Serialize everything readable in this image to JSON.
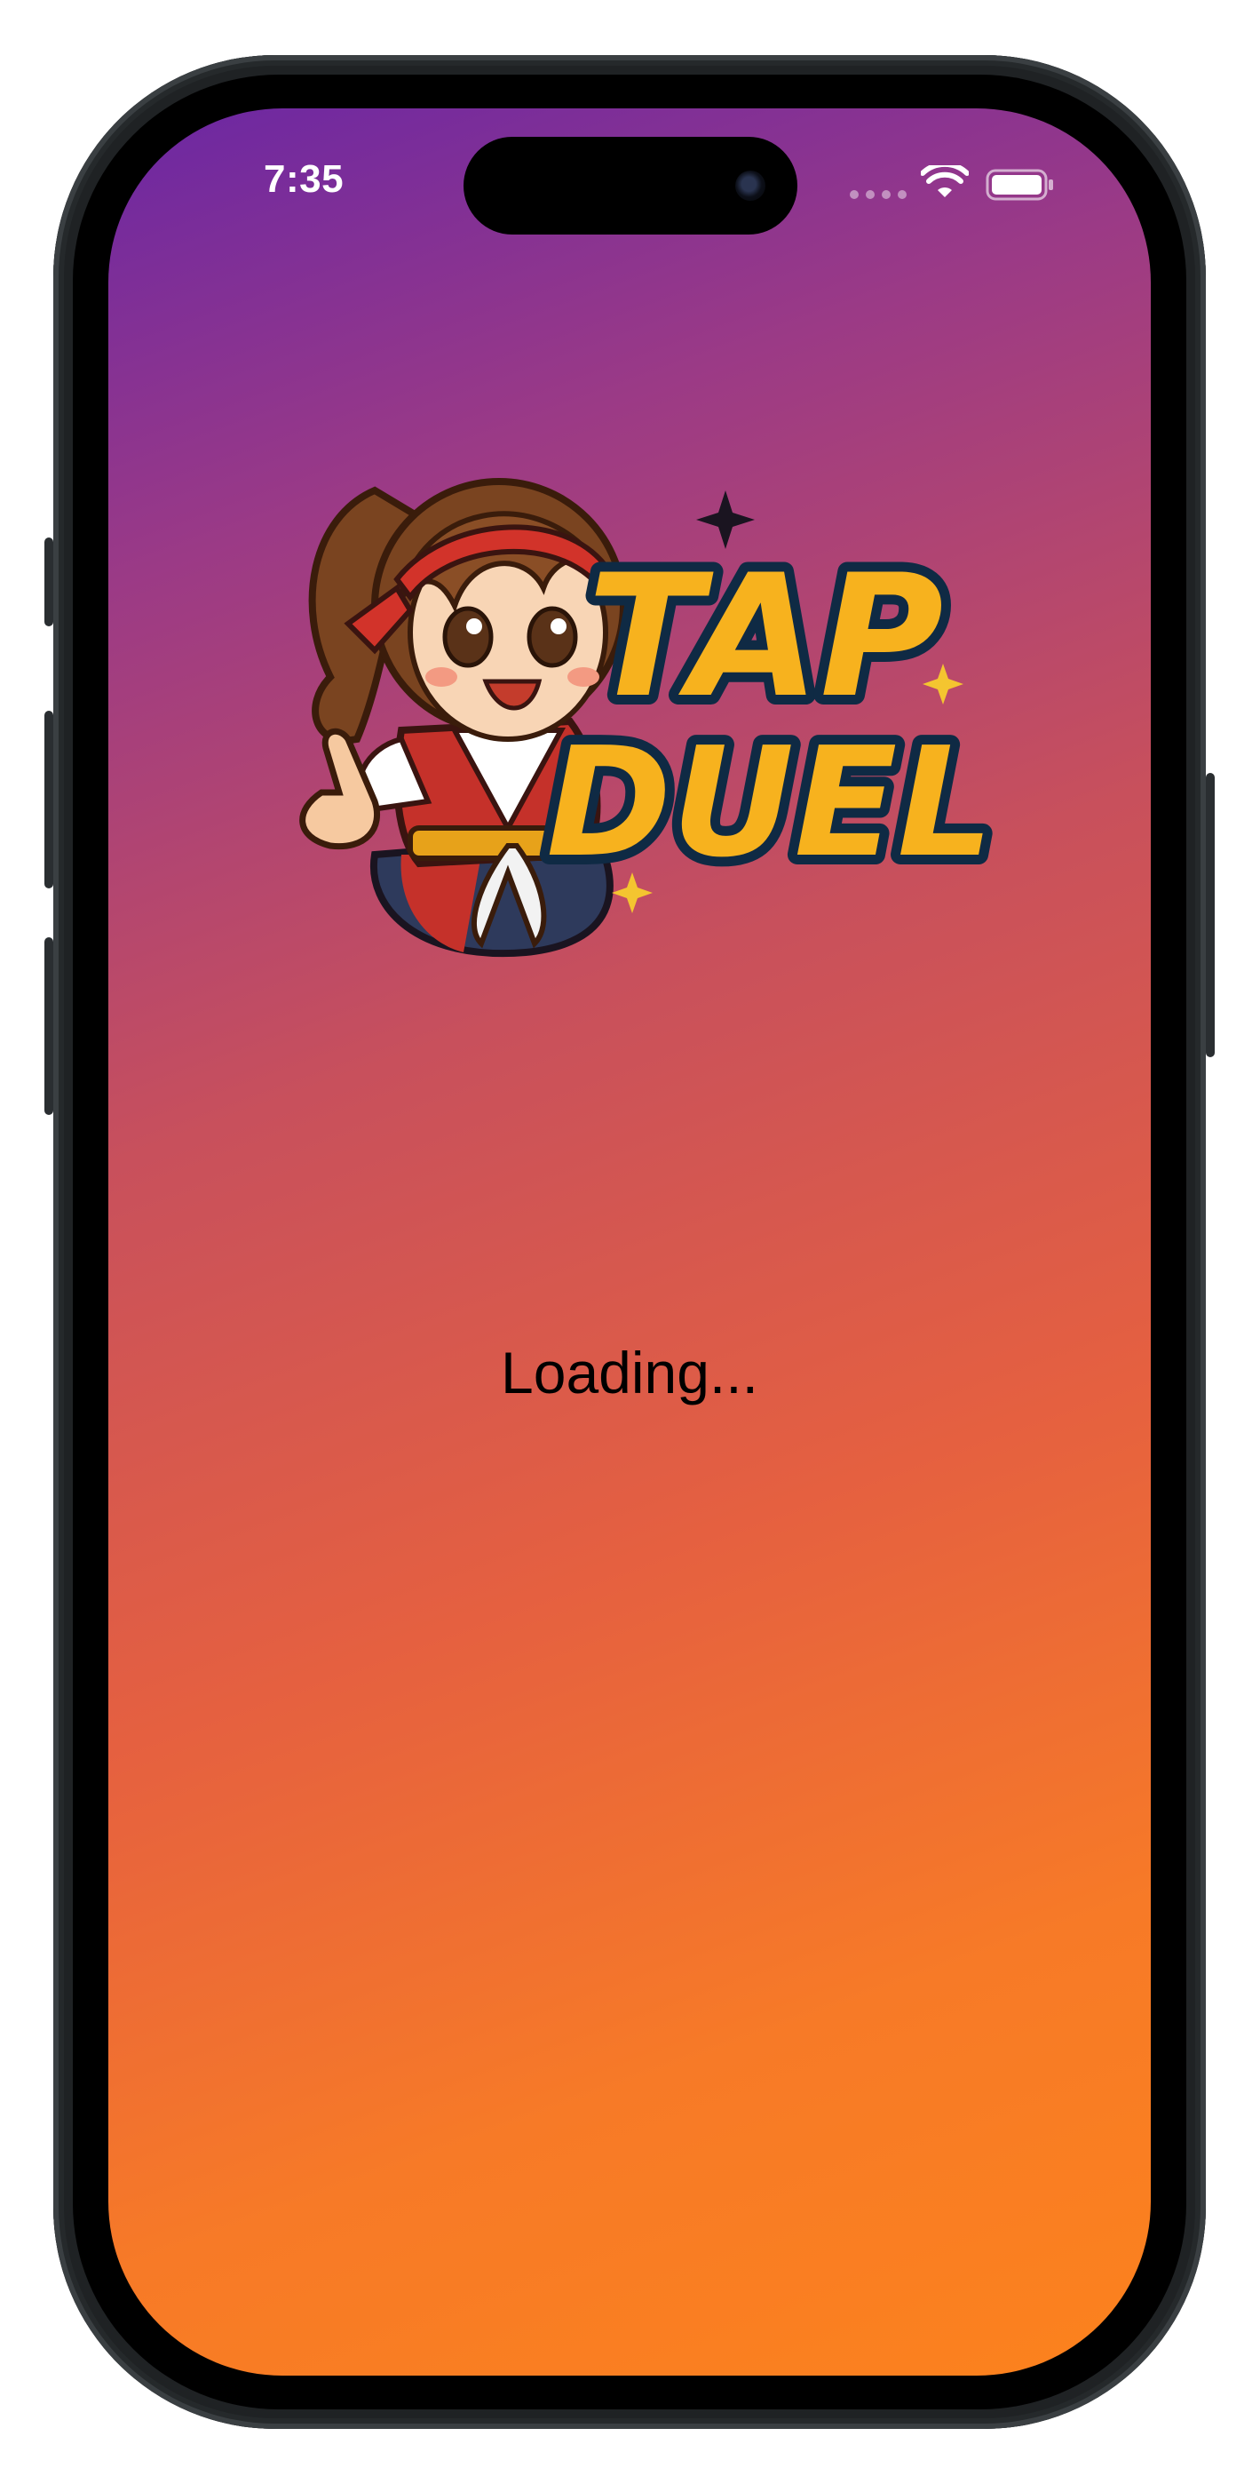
{
  "status_bar": {
    "time": "7:35"
  },
  "splash": {
    "logo_word_1": "TAP",
    "logo_word_2": "DUEL",
    "loading_text": "Loading..."
  },
  "icons": {
    "wifi": "wifi-icon",
    "battery": "battery-icon",
    "signal": "cellular-signal-icon"
  },
  "colors": {
    "gradient_start": "#6b27a3",
    "gradient_end": "#fc821d",
    "logo_text_fill": "#f7b21e",
    "logo_text_outline": "#0f2a44",
    "loading_text": "#000000"
  }
}
